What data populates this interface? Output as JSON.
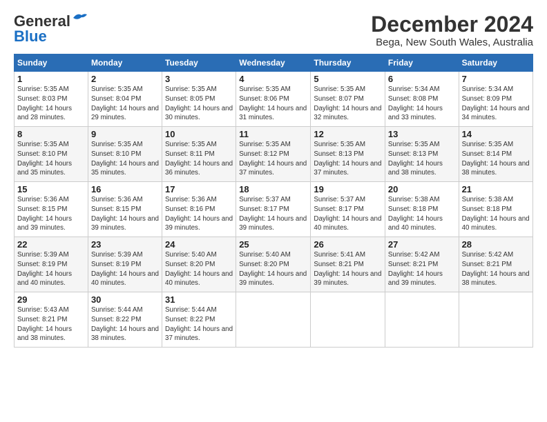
{
  "logo": {
    "line1": "General",
    "line2": "Blue"
  },
  "header": {
    "title": "December 2024",
    "location": "Bega, New South Wales, Australia"
  },
  "weekdays": [
    "Sunday",
    "Monday",
    "Tuesday",
    "Wednesday",
    "Thursday",
    "Friday",
    "Saturday"
  ],
  "weeks": [
    [
      {
        "day": "1",
        "sunrise": "5:35 AM",
        "sunset": "8:03 PM",
        "daylight": "14 hours and 28 minutes."
      },
      {
        "day": "2",
        "sunrise": "5:35 AM",
        "sunset": "8:04 PM",
        "daylight": "14 hours and 29 minutes."
      },
      {
        "day": "3",
        "sunrise": "5:35 AM",
        "sunset": "8:05 PM",
        "daylight": "14 hours and 30 minutes."
      },
      {
        "day": "4",
        "sunrise": "5:35 AM",
        "sunset": "8:06 PM",
        "daylight": "14 hours and 31 minutes."
      },
      {
        "day": "5",
        "sunrise": "5:35 AM",
        "sunset": "8:07 PM",
        "daylight": "14 hours and 32 minutes."
      },
      {
        "day": "6",
        "sunrise": "5:34 AM",
        "sunset": "8:08 PM",
        "daylight": "14 hours and 33 minutes."
      },
      {
        "day": "7",
        "sunrise": "5:34 AM",
        "sunset": "8:09 PM",
        "daylight": "14 hours and 34 minutes."
      }
    ],
    [
      {
        "day": "8",
        "sunrise": "5:35 AM",
        "sunset": "8:10 PM",
        "daylight": "14 hours and 35 minutes."
      },
      {
        "day": "9",
        "sunrise": "5:35 AM",
        "sunset": "8:10 PM",
        "daylight": "14 hours and 35 minutes."
      },
      {
        "day": "10",
        "sunrise": "5:35 AM",
        "sunset": "8:11 PM",
        "daylight": "14 hours and 36 minutes."
      },
      {
        "day": "11",
        "sunrise": "5:35 AM",
        "sunset": "8:12 PM",
        "daylight": "14 hours and 37 minutes."
      },
      {
        "day": "12",
        "sunrise": "5:35 AM",
        "sunset": "8:13 PM",
        "daylight": "14 hours and 37 minutes."
      },
      {
        "day": "13",
        "sunrise": "5:35 AM",
        "sunset": "8:13 PM",
        "daylight": "14 hours and 38 minutes."
      },
      {
        "day": "14",
        "sunrise": "5:35 AM",
        "sunset": "8:14 PM",
        "daylight": "14 hours and 38 minutes."
      }
    ],
    [
      {
        "day": "15",
        "sunrise": "5:36 AM",
        "sunset": "8:15 PM",
        "daylight": "14 hours and 39 minutes."
      },
      {
        "day": "16",
        "sunrise": "5:36 AM",
        "sunset": "8:15 PM",
        "daylight": "14 hours and 39 minutes."
      },
      {
        "day": "17",
        "sunrise": "5:36 AM",
        "sunset": "8:16 PM",
        "daylight": "14 hours and 39 minutes."
      },
      {
        "day": "18",
        "sunrise": "5:37 AM",
        "sunset": "8:17 PM",
        "daylight": "14 hours and 39 minutes."
      },
      {
        "day": "19",
        "sunrise": "5:37 AM",
        "sunset": "8:17 PM",
        "daylight": "14 hours and 40 minutes."
      },
      {
        "day": "20",
        "sunrise": "5:38 AM",
        "sunset": "8:18 PM",
        "daylight": "14 hours and 40 minutes."
      },
      {
        "day": "21",
        "sunrise": "5:38 AM",
        "sunset": "8:18 PM",
        "daylight": "14 hours and 40 minutes."
      }
    ],
    [
      {
        "day": "22",
        "sunrise": "5:39 AM",
        "sunset": "8:19 PM",
        "daylight": "14 hours and 40 minutes."
      },
      {
        "day": "23",
        "sunrise": "5:39 AM",
        "sunset": "8:19 PM",
        "daylight": "14 hours and 40 minutes."
      },
      {
        "day": "24",
        "sunrise": "5:40 AM",
        "sunset": "8:20 PM",
        "daylight": "14 hours and 40 minutes."
      },
      {
        "day": "25",
        "sunrise": "5:40 AM",
        "sunset": "8:20 PM",
        "daylight": "14 hours and 39 minutes."
      },
      {
        "day": "26",
        "sunrise": "5:41 AM",
        "sunset": "8:21 PM",
        "daylight": "14 hours and 39 minutes."
      },
      {
        "day": "27",
        "sunrise": "5:42 AM",
        "sunset": "8:21 PM",
        "daylight": "14 hours and 39 minutes."
      },
      {
        "day": "28",
        "sunrise": "5:42 AM",
        "sunset": "8:21 PM",
        "daylight": "14 hours and 38 minutes."
      }
    ],
    [
      {
        "day": "29",
        "sunrise": "5:43 AM",
        "sunset": "8:21 PM",
        "daylight": "14 hours and 38 minutes."
      },
      {
        "day": "30",
        "sunrise": "5:44 AM",
        "sunset": "8:22 PM",
        "daylight": "14 hours and 38 minutes."
      },
      {
        "day": "31",
        "sunrise": "5:44 AM",
        "sunset": "8:22 PM",
        "daylight": "14 hours and 37 minutes."
      },
      null,
      null,
      null,
      null
    ]
  ]
}
